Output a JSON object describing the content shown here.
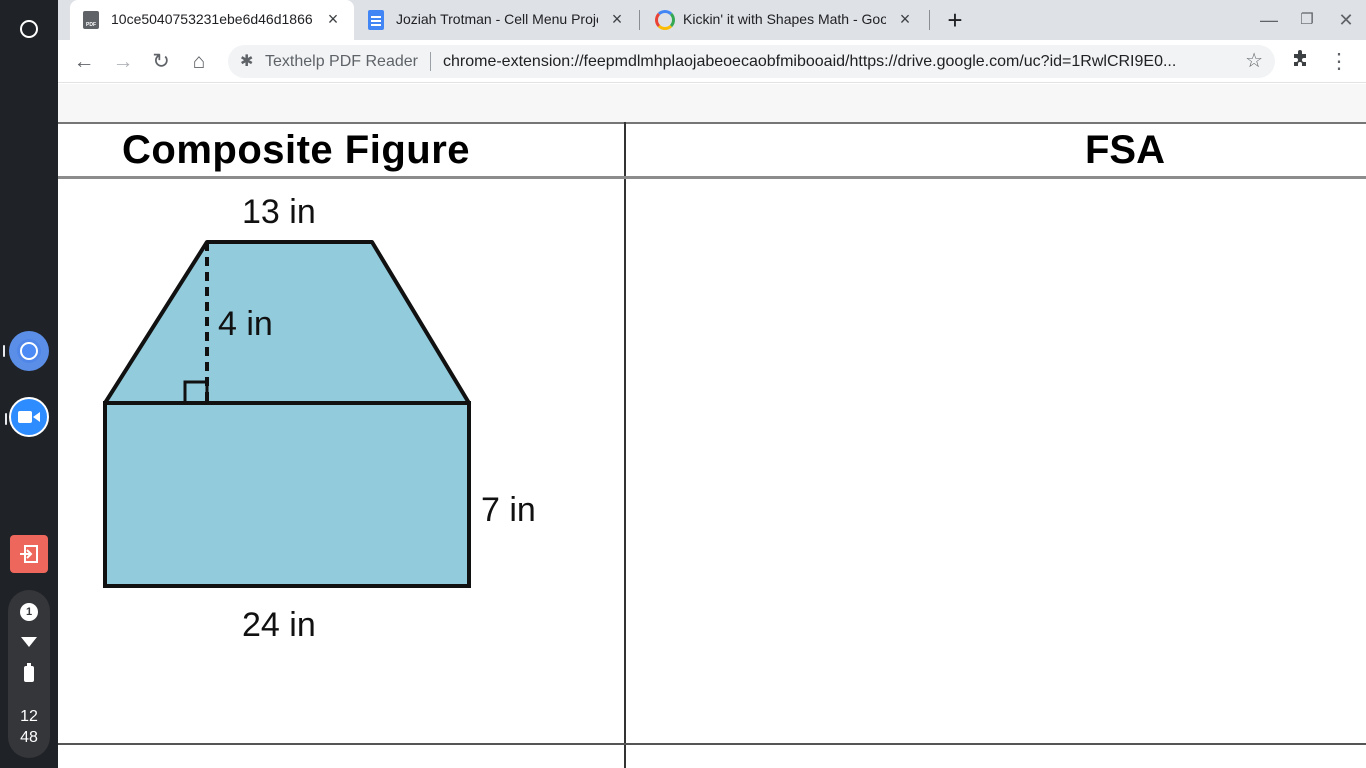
{
  "tabs": [
    {
      "title": "10ce5040753231ebe6d46d1866",
      "favicon": "pdf-icon",
      "active": true
    },
    {
      "title": "Joziah Trotman - Cell Menu Proje",
      "favicon": "docs-icon",
      "active": false
    },
    {
      "title": "Kickin' it with Shapes Math - Goo",
      "favicon": "google-icon",
      "active": false
    }
  ],
  "omnibox": {
    "extension_name": "Texthelp PDF Reader",
    "url": "chrome-extension://feepmdlmhplaojabeoecaobfmibooaid/https://drive.google.com/uc?id=1RwlCRI9E0..."
  },
  "pdf_favicon_label": "PDF",
  "document": {
    "col_left_header": "Composite Figure",
    "col_right_header": "FSA",
    "figure": {
      "top_label": "13 in",
      "height_label": "4 in",
      "side_label": "7 in",
      "bottom_label": "24 in",
      "fill_color": "#91cbdc"
    }
  },
  "tray": {
    "notification_count": "1",
    "clock_hour": "12",
    "clock_minute": "48"
  }
}
